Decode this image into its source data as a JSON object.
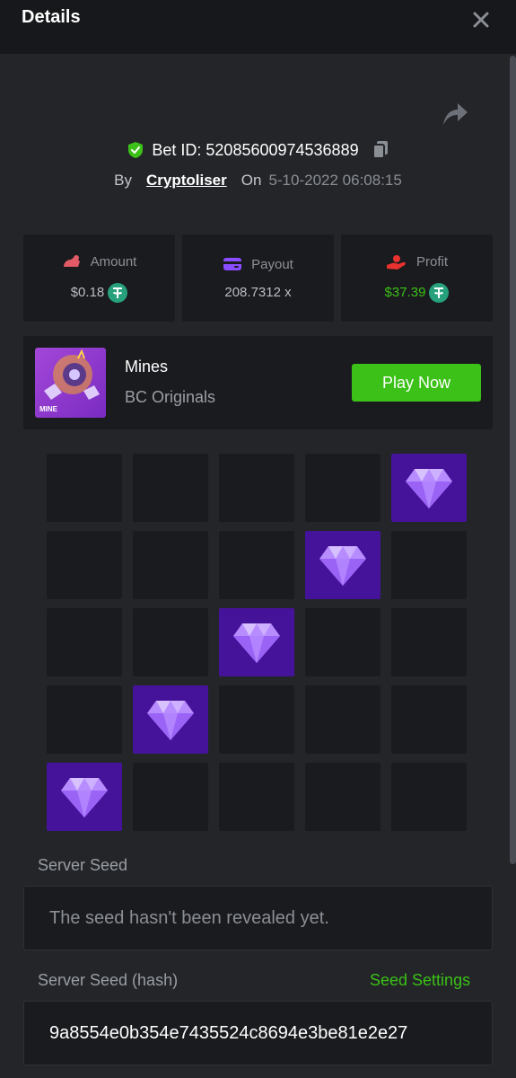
{
  "header": {
    "title": "Details"
  },
  "bet": {
    "id_label": "Bet ID: 52085600974536889",
    "by_label": "By",
    "username": "Cryptoliser",
    "on_label": "On",
    "date": "5-10-2022 06:08:15"
  },
  "stats": [
    {
      "label": "Amount",
      "value": "$0.18",
      "icon": "amount-icon",
      "color": "#e25a66"
    },
    {
      "label": "Payout",
      "value": "208.7312 x",
      "icon": "wallet-icon",
      "color": "#8a4dff"
    },
    {
      "label": "Profit",
      "value": "$37.39",
      "icon": "profit-hand-icon",
      "color": "#e8322f"
    }
  ],
  "game": {
    "name": "Mines",
    "provider": "BC Originals",
    "thumb_label": "MINE",
    "play_label": "Play Now"
  },
  "board": {
    "rows": 5,
    "cols": 5,
    "gems": [
      [
        0,
        4
      ],
      [
        1,
        3
      ],
      [
        2,
        2
      ],
      [
        3,
        1
      ],
      [
        4,
        0
      ]
    ]
  },
  "seeds": {
    "server_seed_label": "Server Seed",
    "server_seed_value": "The seed hasn't been revealed yet.",
    "server_hash_label": "Server Seed (hash)",
    "seed_settings_label": "Seed Settings",
    "server_hash_value": "9a8554e0b354e7435524c8694e3be81e2e27"
  },
  "colors": {
    "accent_green": "#3bc117",
    "gem_tile": "#45139a",
    "background": "#232528",
    "panel": "#1a1b1e"
  }
}
